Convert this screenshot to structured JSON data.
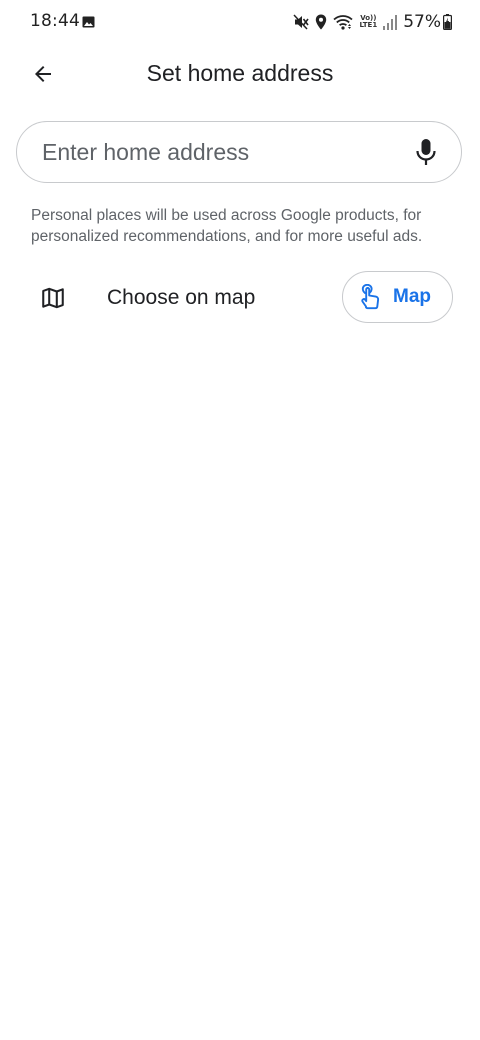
{
  "status_bar": {
    "time": "18:44",
    "volte_line1": "Vo))",
    "volte_line2": "LTE1",
    "battery": "57%",
    "icons": [
      "gallery-icon",
      "mute-icon",
      "location-icon",
      "wifi-icon",
      "signal-icon",
      "battery-icon"
    ]
  },
  "app_bar": {
    "title": "Set home address",
    "back_icon": "arrow-left-icon"
  },
  "search": {
    "value": "",
    "placeholder": "Enter home address",
    "mic_icon": "microphone-icon"
  },
  "disclaimer": "Personal places will be used across Google products, for personalized recommendations, and for more useful ads.",
  "choose_on_map": {
    "label": "Choose on map",
    "icon": "map-icon",
    "button_label": "Map",
    "button_icon": "tap-icon"
  },
  "colors": {
    "accent": "#1a73e8",
    "text_primary": "#202124",
    "text_secondary": "#5f6368",
    "border": "#c8cacd"
  }
}
